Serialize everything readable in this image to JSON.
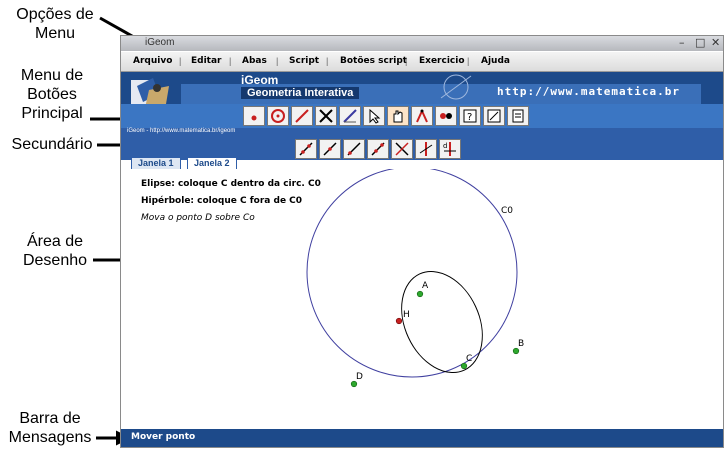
{
  "annotations": {
    "menu_options": "Opções de\nMenu",
    "main_buttons_1": "Menu de",
    "main_buttons_2": "Botões",
    "main_buttons_3": "Principal",
    "secondary": "Secundário",
    "draw_area_1": "Área de",
    "draw_area_2": "Desenho",
    "msg_bar_1": "Barra de",
    "msg_bar_2": "Mensagens"
  },
  "window": {
    "title": "iGeom",
    "controls": [
      "–",
      "□",
      "✕"
    ]
  },
  "menu": {
    "items": [
      "Arquivo",
      "Editar",
      "Abas",
      "Script",
      "Botões script",
      "Exercicio",
      "Ajuda"
    ]
  },
  "banner": {
    "app_name": "iGeom",
    "subtitle": "Geometria Interativa",
    "url": "http://www.matematica.br"
  },
  "url_strip": "iGeom - http://www.matematica.br/igeom",
  "tabs": [
    "Janela 1",
    "Janela 2"
  ],
  "canvas": {
    "instructions": [
      "Elipse: coloque C dentro da circ. C0",
      "Hipérbole: coloque C fora de C0",
      "Mova o ponto D sobre Co"
    ],
    "labels": {
      "circle": "C0",
      "a": "A",
      "b": "B",
      "c": "C",
      "d": "D",
      "h": "H"
    }
  },
  "status": "Mover ponto",
  "colors": {
    "dark_blue": "#1d4a8a",
    "mid_blue": "#3b76c3",
    "point_green": "#2ea82e",
    "point_red": "#c82020"
  }
}
